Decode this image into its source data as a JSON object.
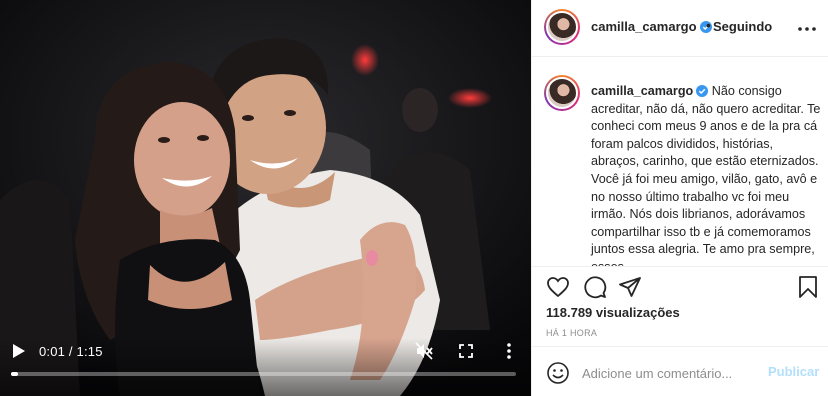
{
  "post": {
    "username": "camilla_camargo",
    "follow_separator": "•",
    "follow_status": "Seguindo",
    "caption": "Não consigo acreditar, não dá, não quero acreditar. Te conheci com meus 9 anos e de la pra cá foram palcos divididos, histórias, abraços, carinho, que estão eternizados. Você já foi meu amigo, vilão, gato, avô e no nosso último trabalho vc foi meu irmão. Nós dois librianos, adorávamos compartilhar isso tb e já comemoramos juntos essa alegria. Te amo pra sempre, esses",
    "views": "118.789 visualizações",
    "time_ago": "HÁ 1 HORA"
  },
  "video": {
    "time_display": "0:01 / 1:15",
    "progress": 0.013
  },
  "comment_box": {
    "placeholder": "Adicione um comentário...",
    "publish_label": "Publicar"
  },
  "icons": {
    "play": "play-icon",
    "mute": "volume-muted-icon",
    "fullscreen": "fullscreen-icon",
    "video_more": "more-vertical-icon",
    "header_more": "more-horizontal-icon",
    "verified": "verified-badge-icon",
    "like": "heart-icon",
    "comment": "comment-bubble-icon",
    "share": "paper-plane-icon",
    "save": "bookmark-icon",
    "emoji": "smiley-icon"
  },
  "colors": {
    "verified": "#3897f0",
    "publish_disabled": "#b2dffc",
    "muted_text": "#8e8e8e",
    "divider": "#efefef"
  }
}
